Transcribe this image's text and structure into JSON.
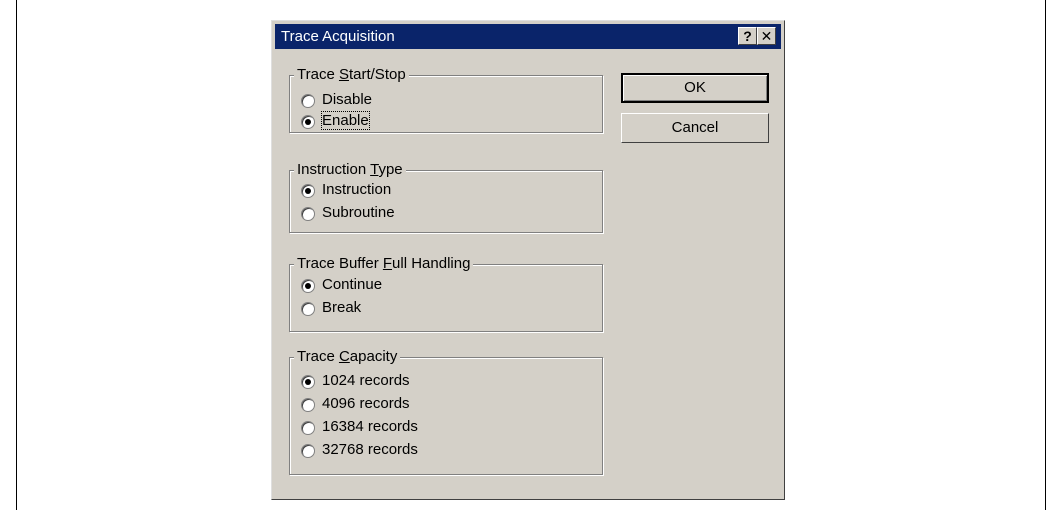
{
  "dialog": {
    "title": "Trace Acquisition",
    "help_button": "?",
    "close_button": "✕"
  },
  "groups": [
    {
      "legend_pre": "Trace ",
      "legend_accel": "S",
      "legend_post": "tart/Stop",
      "options": [
        {
          "label": "Disable",
          "selected": false
        },
        {
          "label": "Enable",
          "selected": true
        }
      ]
    },
    {
      "legend_pre": "Instruction ",
      "legend_accel": "T",
      "legend_post": "ype",
      "options": [
        {
          "label": "Instruction",
          "selected": true
        },
        {
          "label": "Subroutine",
          "selected": false
        }
      ]
    },
    {
      "legend_pre": "Trace Buffer ",
      "legend_accel": "F",
      "legend_post": "ull Handling",
      "options": [
        {
          "label": "Continue",
          "selected": true
        },
        {
          "label": "Break",
          "selected": false
        }
      ]
    },
    {
      "legend_pre": "Trace ",
      "legend_accel": "C",
      "legend_post": "apacity",
      "options": [
        {
          "label": "1024 records",
          "selected": true
        },
        {
          "label": "4096 records",
          "selected": false
        },
        {
          "label": "16384 records",
          "selected": false
        },
        {
          "label": "32768 records",
          "selected": false
        }
      ]
    }
  ],
  "buttons": {
    "ok_label": "OK",
    "cancel_label": "Cancel"
  }
}
